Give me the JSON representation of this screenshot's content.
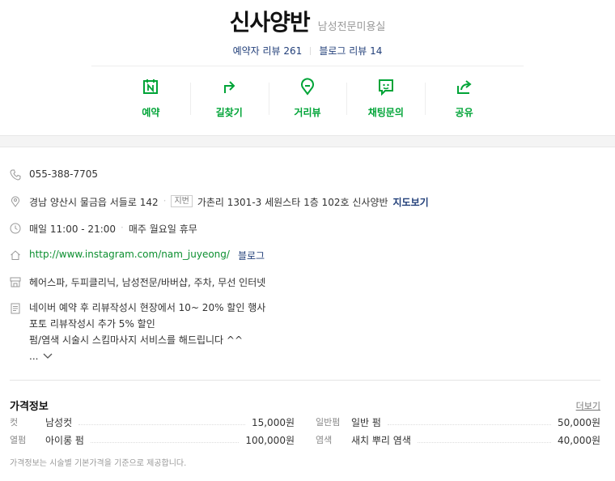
{
  "header": {
    "title": "신사양반",
    "category": "남성전문미용실",
    "visitor_reviews_label": "예약자 리뷰",
    "visitor_reviews_count": "261",
    "blog_reviews_label": "블로그 리뷰",
    "blog_reviews_count": "14"
  },
  "actions": [
    {
      "label": "예약",
      "icon": "calendar-n-icon"
    },
    {
      "label": "길찾기",
      "icon": "directions-arrow-icon"
    },
    {
      "label": "거리뷰",
      "icon": "map-pin-icon"
    },
    {
      "label": "채팅문의",
      "icon": "chat-bubble-icon"
    },
    {
      "label": "공유",
      "icon": "share-icon"
    }
  ],
  "info": {
    "phone": "055-388-7705",
    "address": "경남 양산시 물금읍 서들로 142",
    "jibun_tag": "지번",
    "jibun_address": "가촌리 1301-3 세원스타 1층 102호 신사양반",
    "map_link": "지도보기",
    "hours": "매일 11:00 - 21:00",
    "closed": "매주 월요일 휴무",
    "website": "http://www.instagram.com/nam_juyeong/",
    "blog_link": "블로그",
    "amenities": "헤어스파, 두피클리닉, 남성전문/바버샵, 주차, 무선 인터넷",
    "description_lines": [
      "네이버 예약 후 리뷰작성시 현장에서 10~ 20%  할인 행사",
      "포토 리뷰작성시 추가 5% 할인",
      "펌/염색 시술시 스킴마사지 서비스를 해드립니다 ^^"
    ],
    "more_ellipsis": "..."
  },
  "price": {
    "title": "가격정보",
    "more": "더보기",
    "items": [
      {
        "category": "컷",
        "name": "남성컷",
        "price": "15,000원"
      },
      {
        "category": "일반펌",
        "name": "일반 펌",
        "price": "50,000원"
      },
      {
        "category": "열펌",
        "name": "아이롱 펌",
        "price": "100,000원"
      },
      {
        "category": "염색",
        "name": "새치 뿌리 염색",
        "price": "40,000원"
      }
    ],
    "note": "가격정보는 시술별 기본가격을 기준으로 제공합니다."
  },
  "colors": {
    "accent_green": "#00a437",
    "link_blue": "#23407a"
  }
}
